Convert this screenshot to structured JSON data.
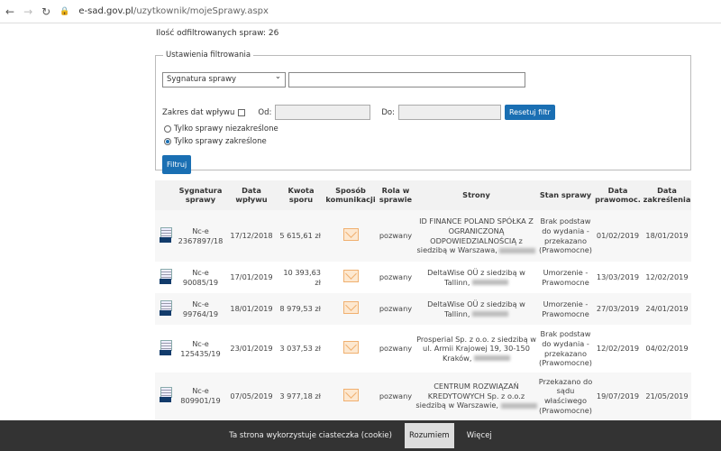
{
  "browser": {
    "url_host": "e-sad.gov.pl",
    "url_path": "/uzytkownik/mojeSprawy.aspx"
  },
  "count_label": "Ilość odfiltrowanych spraw: 26",
  "filter": {
    "legend": "Ustawienia filtrowania",
    "select_value": "Sygnatura sprawy",
    "date_range_label": "Zakres dat wpływu",
    "from_label": "Od:",
    "to_label": "Do:",
    "reset_label": "Resetuj filtr",
    "radio1": "Tylko sprawy niezakreślone",
    "radio2": "Tylko sprawy zakreślone",
    "filter_label": "Filtruj"
  },
  "table": {
    "headers": [
      "Sygnatura sprawy",
      "Data wpływu",
      "Kwota sporu",
      "Sposób komunikacji",
      "Rola w sprawie",
      "Strony",
      "Stan sprawy",
      "Data prawomoc.",
      "Data zakreślenia"
    ],
    "rows": [
      {
        "syg": "Nc-e 2367897/18",
        "data": "17/12/2018",
        "kwota": "5 615,61 zł",
        "rola": "pozwany",
        "strony": "ID FINANCE POLAND SPÓŁKA Z OGRANICZONĄ ODPOWIEDZIALNOŚCIĄ z siedzibą w Warszawa,",
        "stan": "Brak podstaw do wydania - przekazano (Prawomocne)",
        "prawomoc": "01/02/2019",
        "zakr": "18/01/2019"
      },
      {
        "syg": "Nc-e 90085/19",
        "data": "17/01/2019",
        "kwota": "10 393,63 zł",
        "rola": "pozwany",
        "strony": "DeltaWise OÜ z siedzibą w Tallinn,",
        "stan": "Umorzenie - Prawomocne",
        "prawomoc": "13/03/2019",
        "zakr": "12/02/2019"
      },
      {
        "syg": "Nc-e 99764/19",
        "data": "18/01/2019",
        "kwota": "8 979,53 zł",
        "rola": "pozwany",
        "strony": "DeltaWise OÜ z siedzibą w Tallinn,",
        "stan": "Umorzenie - Prawomocne",
        "prawomoc": "27/03/2019",
        "zakr": "24/01/2019"
      },
      {
        "syg": "Nc-e 125435/19",
        "data": "23/01/2019",
        "kwota": "3 037,53 zł",
        "rola": "pozwany",
        "strony": "Prosperial Sp. z o.o. z siedzibą w ul. Armii Krajowej 19, 30-150 Kraków,",
        "stan": "Brak podstaw do wydania - przekazano (Prawomocne)",
        "prawomoc": "12/02/2019",
        "zakr": "04/02/2019"
      },
      {
        "syg": "Nc-e 809901/19",
        "data": "07/05/2019",
        "kwota": "3 977,18 zł",
        "rola": "pozwany",
        "strony": "CENTRUM ROZWIĄZAŃ KREDYTOWYCH Sp. z o.o.z siedzibą w Warszawie,",
        "stan": "Przekazano do sądu właściwego (Prawomocne)",
        "prawomoc": "19/07/2019",
        "zakr": "21/05/2019"
      }
    ]
  },
  "cookie": {
    "text": "Ta strona wykorzystuje ciasteczka (cookie)",
    "accept": "Rozumiem",
    "more": "Więcej"
  }
}
